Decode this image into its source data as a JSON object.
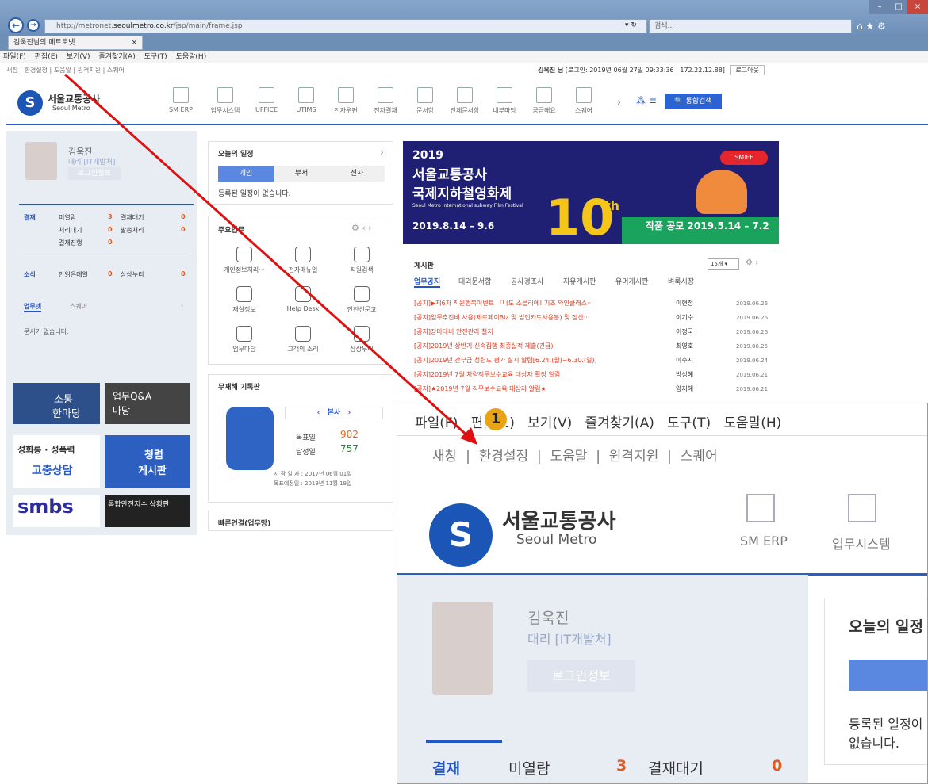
{
  "browser": {
    "url_prefix": "http://metronet.",
    "url_domain": "seoulmetro.co.kr",
    "url_path": "/jsp/main/frame.jsp",
    "search_placeholder": "검색...",
    "tab_title": "김욱진님의 메트로넷",
    "menu": [
      "파일(F)",
      "편집(E)",
      "보기(V)",
      "즐겨찾기(A)",
      "도구(T)",
      "도움말(H)"
    ]
  },
  "site": {
    "topbar_links": [
      "새창",
      "환경설정",
      "도움말",
      "원격지원",
      "스퀘어"
    ],
    "user_greeting": "김욱진 님",
    "login_info": "[로그인: 2019년 06월 27일 09:33:36 | 172.22.12.88]",
    "logout": "로그아웃",
    "logo_ko": "서울교통공사",
    "logo_en": "Seoul Metro",
    "gnb": [
      "SM ERP",
      "업무시스템",
      "UFFICE",
      "UTIMS",
      "전자우편",
      "전자결재",
      "문서함",
      "전체문서함",
      "내부마당",
      "궁금해요",
      "스퀘어"
    ],
    "search_btn": "통합검색"
  },
  "profile": {
    "name": "김욱진",
    "title": "대리 [IT개발처]",
    "login_btn": "로그인정보"
  },
  "approval": {
    "label": "결재",
    "items": [
      {
        "label": "미열람",
        "value": "3"
      },
      {
        "label": "결재대기",
        "value": "0"
      },
      {
        "label": "처리대기",
        "value": "0"
      },
      {
        "label": "발송처리",
        "value": "0"
      },
      {
        "label": "결재진행",
        "value": "0"
      }
    ]
  },
  "news": {
    "label": "소식",
    "items": [
      {
        "label": "안읽은메일",
        "value": "0"
      },
      {
        "label": "상상누리",
        "value": "0"
      }
    ]
  },
  "worknet": {
    "tab1": "업무넷",
    "tab2": "스퀘어",
    "empty": "문서가 없습니다."
  },
  "banners": {
    "b1_l1": "소통",
    "b1_l2": "한마당",
    "b2_l1": "업무Q&A",
    "b2_l2": "마당",
    "b3_l1": "성희롱 · 성폭력",
    "b3_l2": "고충상담",
    "b4_l1": "청렴",
    "b4_l2": "게시판",
    "b5": "smbs",
    "b6": "통합안전지수 상황판"
  },
  "schedule": {
    "title": "오늘의 일정",
    "tabs": [
      "개인",
      "부서",
      "전사"
    ],
    "empty": "등록된 일정이 없습니다."
  },
  "tasks": {
    "title": "주요업무",
    "items": [
      "개인정보처리···",
      "전자매뉴얼",
      "직원검색",
      "재실정보",
      "Help Desk",
      "안전신문고",
      "업무마당",
      "고객의 소리",
      "상상누리"
    ]
  },
  "safety": {
    "title": "무재해 기록판",
    "branch": "본사",
    "target_label": "목표일",
    "target": "902",
    "achieved_label": "달성일",
    "achieved": "757",
    "start": "시 작 일 자 : 2017년 06월 01일",
    "goal": "목표예정일 : 2019년 11월 19일"
  },
  "quicklinks": {
    "title": "빠른연결(업무망)"
  },
  "banner": {
    "year": "2019",
    "line1": "서울교통공사",
    "line2": "국제지하철영화제",
    "sub": "Seoul Metro International subway Film Festival",
    "dates": "2019.8.14 – 9.6",
    "tenth": "10",
    "th": "th",
    "contest": "작품 공모 2019.5.14 – 7.2",
    "smiff": "SMIFF"
  },
  "board": {
    "title": "게시판",
    "count": "15개",
    "tabs": [
      "업무공지",
      "대외문서함",
      "공사경조사",
      "자유게시판",
      "유머게시판",
      "벼룩시장"
    ],
    "rows": [
      {
        "t": "[공지]▶제6차 직원행복이벤트 『나도 소믈리에! 기초 와인클래스···",
        "a": "이현정",
        "d": "2019.06.26"
      },
      {
        "t": "[공지]업무추진비 사용(제로페이Biz 및 법인카드사용분) 및 정산···",
        "a": "이기수",
        "d": "2019.06.26"
      },
      {
        "t": "[공지]장마대비 안전관리 철저",
        "a": "이정국",
        "d": "2019.06.26"
      },
      {
        "t": "[공지]2019년 상반기 신속집행 최종실적 제출(긴급)",
        "a": "최영호",
        "d": "2019.06.25"
      },
      {
        "t": "[공지]2019년 간부급 청렴도 평가 실시 알림[6.24.(월)~6.30.(일)]",
        "a": "이수지",
        "d": "2019.06.24"
      },
      {
        "t": "[공지]2019년 7월 차량직무보수교육 대상자 확정 알림",
        "a": "방성혜",
        "d": "2019.06.21"
      },
      {
        "t": "[공지]★2019년 7월 직무보수교육 대상자 알림★",
        "a": "양지혜",
        "d": "2019.06.21"
      }
    ]
  },
  "zoom": {
    "menu": [
      "파일(F)",
      "편집(E)",
      "보기(V)",
      "즐겨찾기(A)",
      "도구(T)",
      "도움말(H)"
    ],
    "badge": "1"
  },
  "colors": {
    "accent": "#2a5fc0",
    "arrow": "#e01010",
    "badge": "#e8a317"
  }
}
